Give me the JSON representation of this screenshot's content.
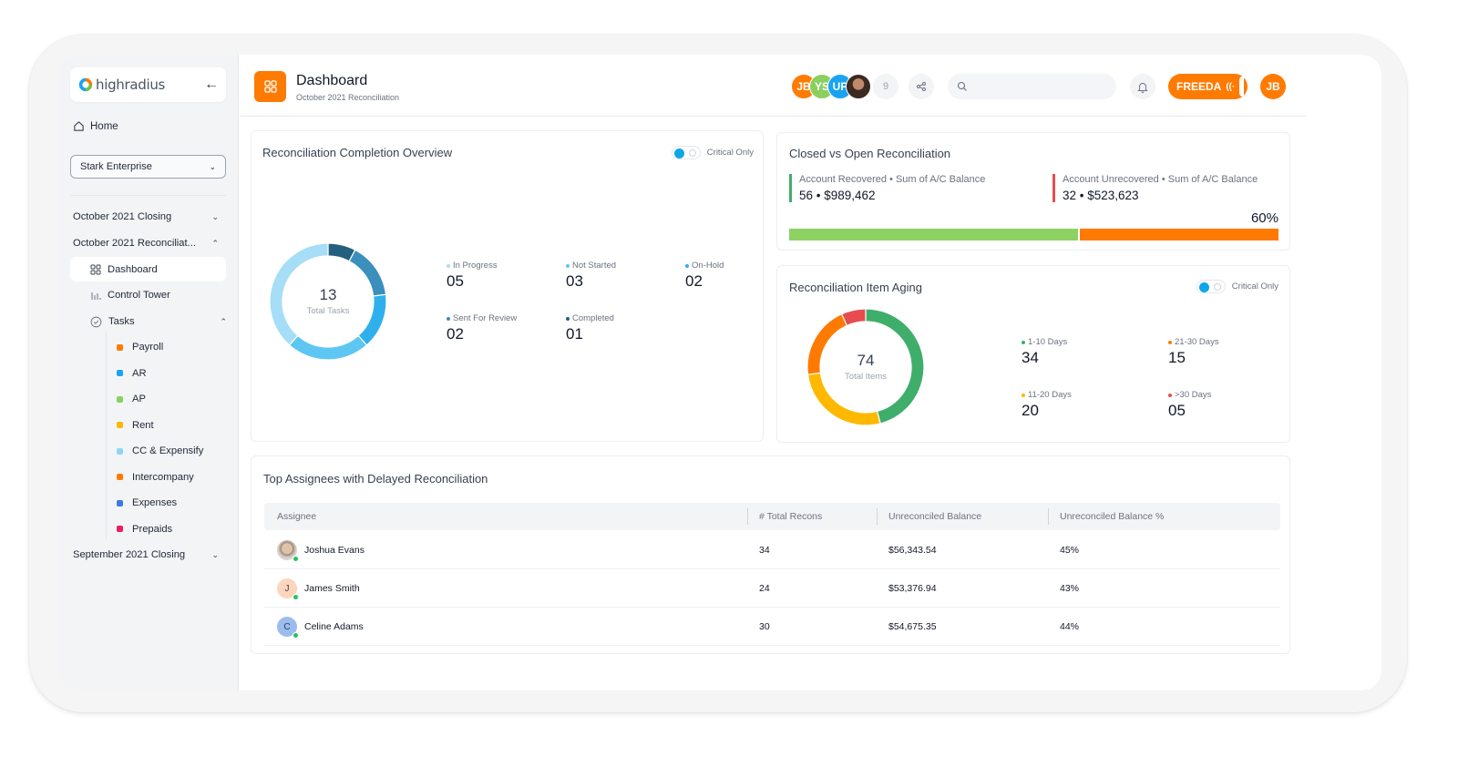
{
  "app": {
    "brand": "highradius",
    "colors": {
      "accent": "#ff7a00",
      "info": "#0ea5e9",
      "success": "#3fae6a",
      "danger": "#e84c4f"
    }
  },
  "sidebar": {
    "home_label": "Home",
    "company_select": {
      "value": "Stark Enterprise"
    },
    "groups": [
      {
        "label": "October 2021 Closing",
        "expanded": false
      },
      {
        "label": "October 2021 Reconciliat...",
        "expanded": true
      },
      {
        "label": "September 2021 Closing",
        "expanded": false
      }
    ],
    "sub_items": [
      {
        "label": "Dashboard",
        "icon": "grid-icon",
        "active": true
      },
      {
        "label": "Control Tower",
        "icon": "bar-chart-icon",
        "active": false
      },
      {
        "label": "Tasks",
        "icon": "check-circle-icon",
        "active": false
      }
    ],
    "tasks": [
      {
        "label": "Payroll",
        "color": "#ff7a00"
      },
      {
        "label": "AR",
        "color": "#1aa3f0"
      },
      {
        "label": "AP",
        "color": "#8bcf5f"
      },
      {
        "label": "Rent",
        "color": "#ffb800"
      },
      {
        "label": "CC & Expensify",
        "color": "#8fd6f5"
      },
      {
        "label": "Intercompany",
        "color": "#ff7a00"
      },
      {
        "label": "Expenses",
        "color": "#3b7be0"
      },
      {
        "label": "Prepaids",
        "color": "#e91e63"
      }
    ]
  },
  "header": {
    "title": "Dashboard",
    "subtitle": "October 2021 Reconciliation",
    "collaborators": [
      {
        "initials": "JB",
        "color": "#ff7a00"
      },
      {
        "initials": "YS",
        "color": "#8bcf5f"
      },
      {
        "initials": "UP",
        "color": "#1aa3f0"
      },
      {
        "initials": "",
        "color": "#5b3a2e",
        "photo": true
      }
    ],
    "collaborators_more": "9",
    "search": {
      "value": "",
      "placeholder": ""
    },
    "assistant_label": "FREEDA",
    "user_initials": "JB"
  },
  "completion_overview": {
    "title": "Reconciliation Completion Overview",
    "toggle_label": "Critical Only",
    "toggle_on": true,
    "total": "13",
    "total_label": "Total Tasks",
    "stats": [
      {
        "label": "In Progress",
        "value": "05",
        "color": "#a6def7"
      },
      {
        "label": "Not Started",
        "value": "03",
        "color": "#5ec6f2"
      },
      {
        "label": "On-Hold",
        "value": "02",
        "color": "#2fb0ec"
      },
      {
        "label": "Sent For Review",
        "value": "02",
        "color": "#3a8fbd"
      },
      {
        "label": "Completed",
        "value": "01",
        "color": "#23607f"
      }
    ]
  },
  "closed_vs_open": {
    "title": "Closed vs Open Reconciliation",
    "recovered": {
      "label": "Account Recovered • Sum of A/C Balance",
      "value": "56 • $989,462",
      "color": "#3fae6a"
    },
    "unrecovered": {
      "label": "Account Unrecovered • Sum of A/C Balance",
      "value": "32 • $523,623",
      "color": "#e84c4f"
    },
    "percent_label": "60%",
    "recovered_fraction": 0.59,
    "bar_colors": {
      "recovered": "#8dd163",
      "unrecovered": "#ff7a00"
    }
  },
  "item_aging": {
    "title": "Reconciliation Item Aging",
    "toggle_label": "Critical Only",
    "toggle_on": true,
    "total": "74",
    "total_label": "Total Items",
    "stats": [
      {
        "label": "1-10 Days",
        "value": "34",
        "color": "#3fae6a"
      },
      {
        "label": "21-30 Days",
        "value": "15",
        "color": "#ff7a00"
      },
      {
        "label": "11-20 Days",
        "value": "20",
        "color": "#ffb800"
      },
      {
        "label": ">30 Days",
        "value": "05",
        "color": "#e84c4f"
      }
    ]
  },
  "assignees": {
    "title": "Top Assignees with Delayed Reconciliation",
    "columns": [
      "Assignee",
      "# Total Recons",
      "Unreconciled Balance",
      "Unreconciled Balance %"
    ],
    "rows": [
      {
        "name": "Joshua Evans",
        "initial": "",
        "photo": true,
        "avatar_color": "#c9b8a8",
        "total": "34",
        "balance": "$56,343.54",
        "percent": "45%"
      },
      {
        "name": "James Smith",
        "initial": "J",
        "photo": false,
        "avatar_color": "#fcd5bd",
        "total": "24",
        "balance": "$53,376.94",
        "percent": "43%"
      },
      {
        "name": "Celine Adams",
        "initial": "C",
        "photo": false,
        "avatar_color": "#9cbcf0",
        "total": "30",
        "balance": "$54,675.35",
        "percent": "44%"
      }
    ]
  }
}
